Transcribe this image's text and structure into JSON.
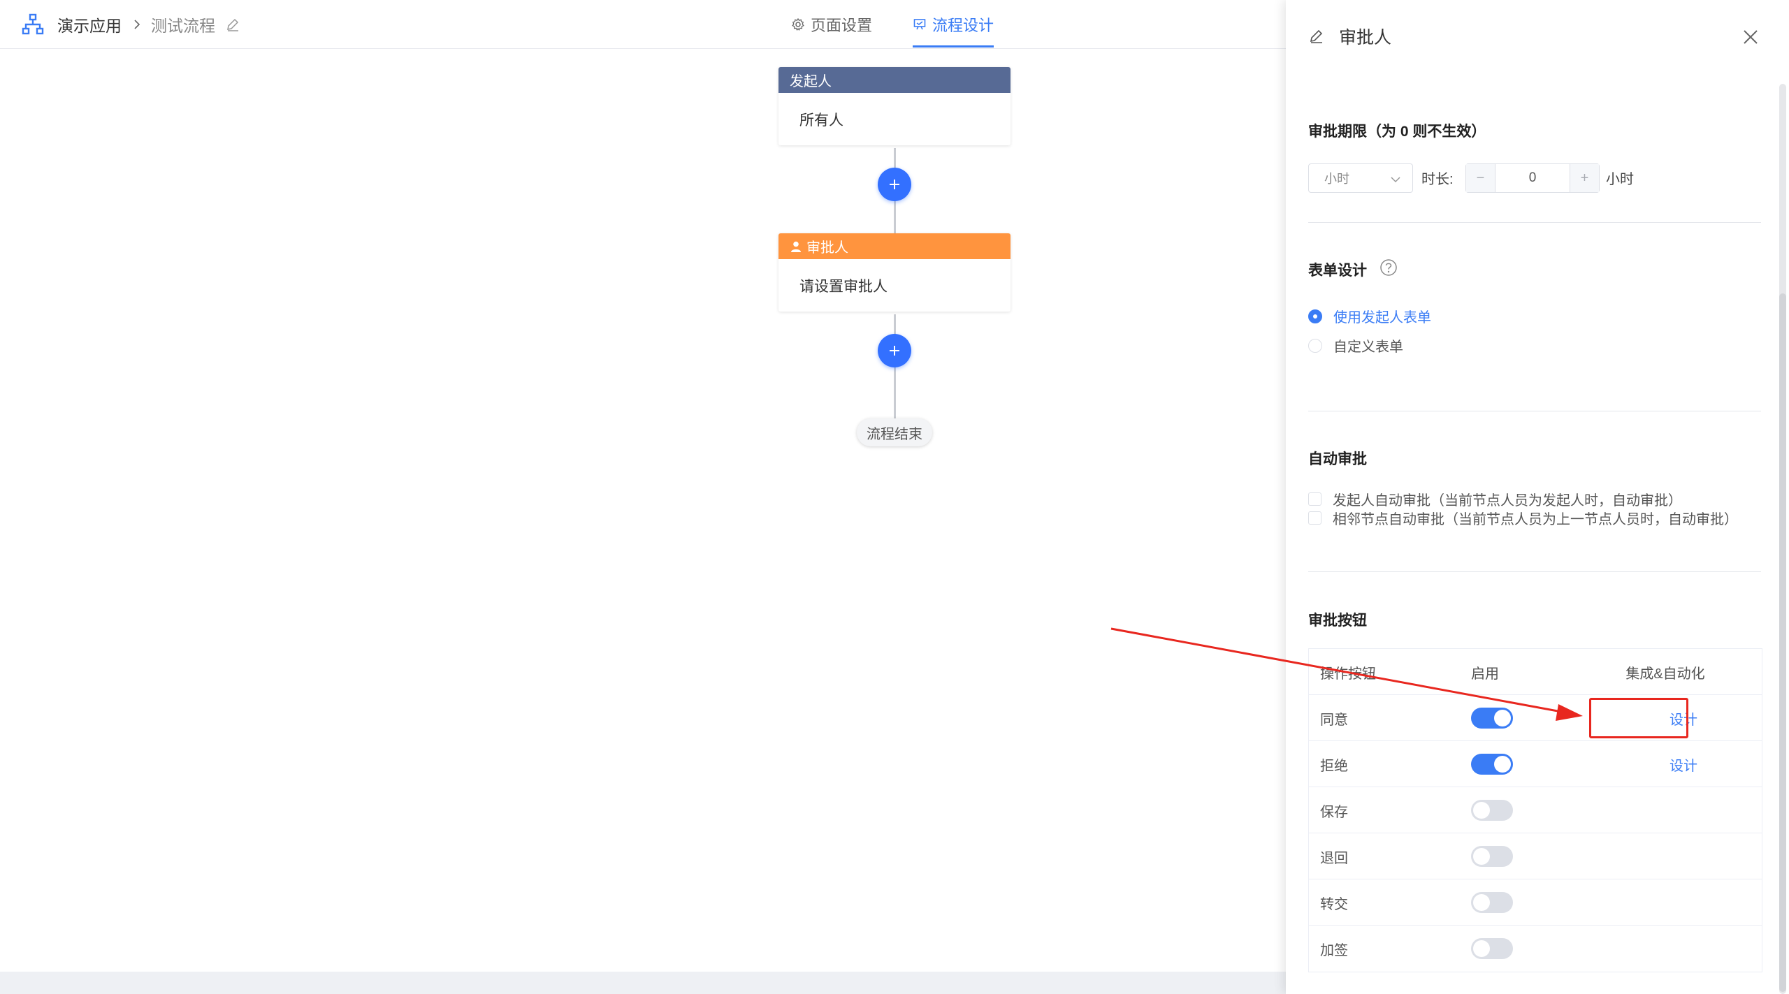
{
  "header": {
    "app_icon": "org-chart-icon",
    "app_name": "演示应用",
    "flow_name": "测试流程",
    "tabs": [
      {
        "label": "页面设置",
        "icon": "gear-icon",
        "active": false
      },
      {
        "label": "流程设计",
        "icon": "flow-design-icon",
        "active": true
      }
    ]
  },
  "flow": {
    "start_node": {
      "title": "发起人",
      "body": "所有人"
    },
    "approver_node": {
      "title": "审批人",
      "icon": "user-icon",
      "body": "请设置审批人"
    },
    "end_label": "流程结束",
    "colors": {
      "start": "#576a95",
      "approver": "#ff943e",
      "add_button": "#3370ff"
    }
  },
  "drawer": {
    "title": "审批人",
    "deadline": {
      "title": "审批期限（为 0 则不生效）",
      "unit_select": "小时",
      "duration_label": "时长:",
      "value": "0",
      "minus": "−",
      "plus": "+",
      "unit_suffix": "小时"
    },
    "form_design": {
      "title": "表单设计",
      "options": [
        {
          "label": "使用发起人表单",
          "checked": true
        },
        {
          "label": "自定义表单",
          "checked": false
        }
      ]
    },
    "auto_approve": {
      "title": "自动审批",
      "options": [
        {
          "label": "发起人自动审批（当前节点人员为发起人时，自动审批）",
          "checked": false
        },
        {
          "label": "相邻节点自动审批（当前节点人员为上一节点人员时，自动审批）",
          "checked": false
        }
      ]
    },
    "buttons": {
      "title": "审批按钮",
      "columns": [
        "操作按钮",
        "启用",
        "集成&自动化"
      ],
      "rows": [
        {
          "name": "同意",
          "enabled": true,
          "action": "设计"
        },
        {
          "name": "拒绝",
          "enabled": true,
          "action": "设计"
        },
        {
          "name": "保存",
          "enabled": false,
          "action": ""
        },
        {
          "name": "退回",
          "enabled": false,
          "action": ""
        },
        {
          "name": "转交",
          "enabled": false,
          "action": ""
        },
        {
          "name": "加签",
          "enabled": false,
          "action": ""
        }
      ]
    }
  },
  "annotation": {
    "color": "#e8271f"
  }
}
